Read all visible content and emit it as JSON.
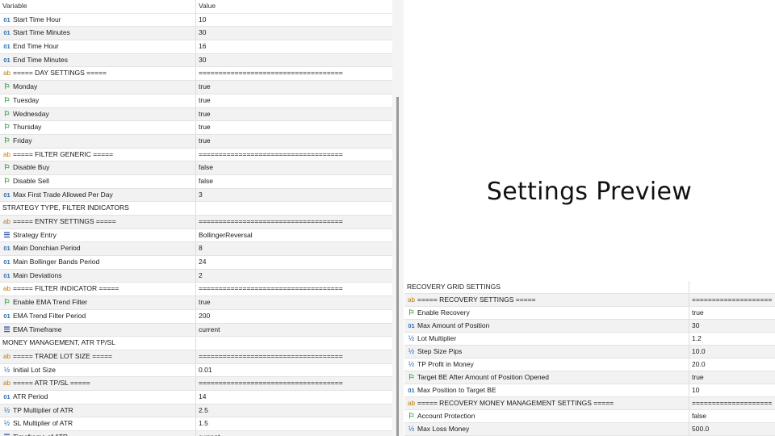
{
  "left_table": {
    "header": {
      "name": "Variable",
      "value": "Value"
    },
    "rows": [
      {
        "icon": "int-icon",
        "name": "Start Time Hour",
        "value": "10"
      },
      {
        "icon": "int-icon",
        "name": "Start Time Minutes",
        "value": "30"
      },
      {
        "icon": "int-icon",
        "name": "End Time Hour",
        "value": "16"
      },
      {
        "icon": "int-icon",
        "name": "End Time Minutes",
        "value": "30"
      },
      {
        "icon": "string-icon",
        "name": "===== DAY SETTINGS =====",
        "value": "===================================="
      },
      {
        "icon": "bool-icon",
        "name": "Monday",
        "value": "true"
      },
      {
        "icon": "bool-icon",
        "name": "Tuesday",
        "value": "true"
      },
      {
        "icon": "bool-icon",
        "name": "Wednesday",
        "value": "true"
      },
      {
        "icon": "bool-icon",
        "name": "Thursday",
        "value": "true"
      },
      {
        "icon": "bool-icon",
        "name": "Friday",
        "value": "true"
      },
      {
        "icon": "string-icon",
        "name": "===== FILTER GENERIC =====",
        "value": "===================================="
      },
      {
        "icon": "bool-icon",
        "name": "Disable Buy",
        "value": "false"
      },
      {
        "icon": "bool-icon",
        "name": "Disable Sell",
        "value": "false"
      },
      {
        "icon": "int-icon",
        "name": "Max First Trade Allowed Per Day",
        "value": "3"
      },
      {
        "icon": "none",
        "name": "STRATEGY TYPE, FILTER INDICATORS",
        "value": ""
      },
      {
        "icon": "string-icon",
        "name": "===== ENTRY SETTINGS =====",
        "value": "===================================="
      },
      {
        "icon": "enum-icon",
        "name": "Strategy Entry",
        "value": "BollingerReversal"
      },
      {
        "icon": "int-icon",
        "name": "Main Donchian Period",
        "value": "8"
      },
      {
        "icon": "int-icon",
        "name": "Main Bollinger Bands Period",
        "value": "24"
      },
      {
        "icon": "int-icon",
        "name": "Main Deviations",
        "value": "2"
      },
      {
        "icon": "string-icon",
        "name": "===== FILTER INDICATOR =====",
        "value": "===================================="
      },
      {
        "icon": "bool-icon",
        "name": "Enable EMA Trend Filter",
        "value": "true"
      },
      {
        "icon": "int-icon",
        "name": "EMA Trend Filter Period",
        "value": "200"
      },
      {
        "icon": "enum-icon",
        "name": "EMA Timeframe",
        "value": "current"
      },
      {
        "icon": "none",
        "name": "MONEY MANAGEMENT, ATR TP/SL",
        "value": ""
      },
      {
        "icon": "string-icon",
        "name": "===== TRADE LOT SIZE =====",
        "value": "===================================="
      },
      {
        "icon": "double-icon",
        "name": "Initial Lot Size",
        "value": "0.01"
      },
      {
        "icon": "string-icon",
        "name": "===== ATR TP/SL =====",
        "value": "===================================="
      },
      {
        "icon": "int-icon",
        "name": "ATR Period",
        "value": "14"
      },
      {
        "icon": "double-icon",
        "name": "TP Multiplier of ATR",
        "value": "2.5"
      },
      {
        "icon": "double-icon",
        "name": "SL Multiplier of ATR",
        "value": "1.5"
      },
      {
        "icon": "enum-icon",
        "name": "Timeframe of ATR",
        "value": "current"
      },
      {
        "icon": "none",
        "name": "RECOVERY GRID SETTINGS",
        "value": ""
      }
    ]
  },
  "headline": "Settings Preview",
  "right_table": {
    "rows": [
      {
        "icon": "none",
        "name": "RECOVERY GRID SETTINGS",
        "value": ""
      },
      {
        "icon": "string-icon",
        "name": "===== RECOVERY SETTINGS =====",
        "value": "===================="
      },
      {
        "icon": "bool-icon",
        "name": "Enable Recovery",
        "value": "true"
      },
      {
        "icon": "int-icon",
        "name": "Max Amount of Position",
        "value": "30"
      },
      {
        "icon": "double-icon",
        "name": "Lot Multiplier",
        "value": "1.2"
      },
      {
        "icon": "double-icon",
        "name": "Step Size Pips",
        "value": "10.0"
      },
      {
        "icon": "double-icon",
        "name": "TP Profit in Money",
        "value": "20.0"
      },
      {
        "icon": "bool-icon",
        "name": "Target BE After Amount of Position Opened",
        "value": "true"
      },
      {
        "icon": "int-icon",
        "name": "Max Position to Target BE",
        "value": "10"
      },
      {
        "icon": "string-icon",
        "name": "===== RECOVERY MONEY MANAGEMENT SETTINGS =====",
        "value": "===================="
      },
      {
        "icon": "bool-icon",
        "name": "Account Protection",
        "value": "false"
      },
      {
        "icon": "double-icon",
        "name": "Max Loss Money",
        "value": "500.0"
      }
    ]
  },
  "icon_glyphs": {
    "int-icon": "01",
    "string-icon": "ab",
    "bool-icon": "⚐",
    "double-icon": "½",
    "enum-icon": "☰",
    "none": ""
  }
}
